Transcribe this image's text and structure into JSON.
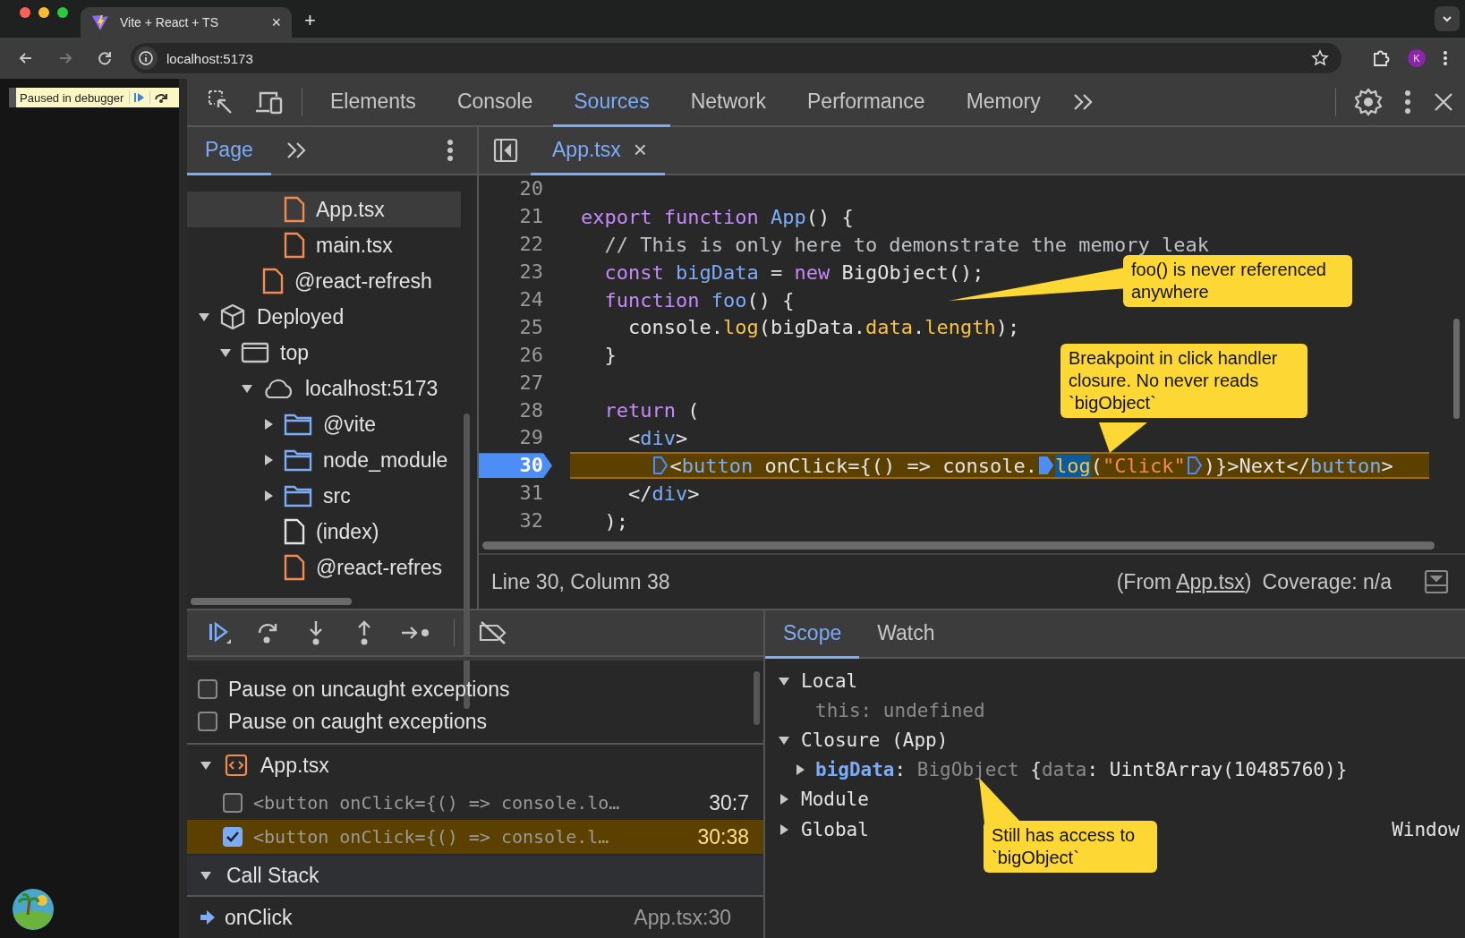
{
  "browser": {
    "tab_title": "Vite + React + TS",
    "tab_close": "×",
    "new_tab": "+",
    "address": "localhost:5173",
    "avatar": "K"
  },
  "page": {
    "paused_label": "Paused in debugger"
  },
  "devtools": {
    "tabs": [
      {
        "label": "Elements",
        "selected": false
      },
      {
        "label": "Console",
        "selected": false
      },
      {
        "label": "Sources",
        "selected": true
      },
      {
        "label": "Network",
        "selected": false
      },
      {
        "label": "Performance",
        "selected": false
      },
      {
        "label": "Memory",
        "selected": false
      }
    ]
  },
  "navigator": {
    "tab": "Page",
    "tab_selected": true,
    "tree": [
      {
        "children": [
          {
            "children": [
              {
                "children": [
                  {
                    "label": "App.tsx",
                    "kind": "file-orange",
                    "selected": true
                  },
                  {
                    "label": "main.tsx",
                    "kind": "file-orange",
                    "selected": false
                  }
                ]
              },
              {
                "label": "@react-refresh",
                "kind": "file-orange",
                "selected": false
              }
            ]
          }
        ]
      },
      {
        "label": "Deployed",
        "kind": "box",
        "selected": false,
        "expanded": true,
        "children": [
          {
            "label": "top",
            "kind": "frame",
            "selected": false,
            "expanded": true,
            "children": [
              {
                "label": "localhost:5173",
                "kind": "cloud",
                "selected": false,
                "expanded": true,
                "children": [
                  {
                    "label": "@vite",
                    "kind": "folder",
                    "selected": false,
                    "expanded": false
                  },
                  {
                    "label": "node_module",
                    "kind": "folder",
                    "selected": false,
                    "expanded": false
                  },
                  {
                    "label": "src",
                    "kind": "folder",
                    "selected": false,
                    "expanded": false
                  },
                  {
                    "label": "(index)",
                    "kind": "file-white",
                    "selected": false
                  },
                  {
                    "label": "@react-refres",
                    "kind": "file-orange",
                    "selected": false
                  }
                ]
              }
            ]
          }
        ]
      }
    ]
  },
  "editor": {
    "file_tab": "App.tsx",
    "file_tab_close": "×",
    "lines": [
      {
        "number": "20"
      },
      {
        "number": "21",
        "tokens": [
          {
            "text": "export",
            "kind": "keyword"
          },
          {
            "text": " function",
            "kind": "keyword"
          },
          {
            "text": " App",
            "kind": "name"
          },
          {
            "text": "() {",
            "kind": "plain"
          }
        ]
      },
      {
        "number": "22",
        "tokens": [
          {
            "text": "  // This is only here to demonstrate the memory leak",
            "kind": "comment"
          }
        ]
      },
      {
        "number": "23",
        "tokens": [
          {
            "text": "  const",
            "kind": "keyword"
          },
          {
            "text": " bigData",
            "kind": "name"
          },
          {
            "text": " = ",
            "kind": "plain"
          },
          {
            "text": "new",
            "kind": "keyword"
          },
          {
            "text": " BigObject();",
            "kind": "plain"
          }
        ]
      },
      {
        "number": "24",
        "tokens": [
          {
            "text": "  function",
            "kind": "keyword"
          },
          {
            "text": " foo",
            "kind": "name"
          },
          {
            "text": "() {",
            "kind": "plain"
          }
        ]
      },
      {
        "number": "25",
        "tokens": [
          {
            "text": "    console.",
            "kind": "plain"
          },
          {
            "text": "log",
            "kind": "prop"
          },
          {
            "text": "(bigData.",
            "kind": "plain"
          },
          {
            "text": "data",
            "kind": "prop"
          },
          {
            "text": ".",
            "kind": "plain"
          },
          {
            "text": "length",
            "kind": "prop"
          },
          {
            "text": ");",
            "kind": "plain"
          }
        ]
      },
      {
        "number": "26",
        "tokens": [
          {
            "text": "  }",
            "kind": "plain"
          }
        ]
      },
      {
        "number": "27"
      },
      {
        "number": "28",
        "tokens": [
          {
            "text": "  return",
            "kind": "keyword"
          },
          {
            "text": " (",
            "kind": "plain"
          }
        ]
      },
      {
        "number": "29",
        "tokens": [
          {
            "text": "    <",
            "kind": "plain"
          },
          {
            "text": "div",
            "kind": "tag"
          },
          {
            "text": ">",
            "kind": "plain"
          }
        ]
      },
      {
        "number": "30",
        "breakpoint": true,
        "paused": true,
        "tokens": [
          {
            "kind": "marker",
            "active": false
          },
          {
            "text": "<",
            "kind": "plain"
          },
          {
            "text": "button",
            "kind": "tag"
          },
          {
            "text": " onClick={() => console.",
            "kind": "plain"
          },
          {
            "kind": "marker",
            "active": true
          },
          {
            "text": "log",
            "kind": "current"
          },
          {
            "text": "(",
            "kind": "plain"
          },
          {
            "text": "\"Click\"",
            "kind": "string"
          },
          {
            "kind": "marker",
            "active": false
          },
          {
            "text": ")}>Next</",
            "kind": "plain"
          },
          {
            "text": "button",
            "kind": "tag"
          },
          {
            "text": ">",
            "kind": "plain"
          }
        ]
      },
      {
        "number": "31",
        "tokens": [
          {
            "text": "    </",
            "kind": "plain"
          },
          {
            "text": "div",
            "kind": "tag"
          },
          {
            "text": ">",
            "kind": "plain"
          }
        ]
      },
      {
        "number": "32",
        "tokens": [
          {
            "text": "  );",
            "kind": "plain"
          }
        ]
      }
    ],
    "status": {
      "position": "Line 30, Column 38",
      "from_prefix": "(From ",
      "from_link": "App.tsx",
      "from_suffix": ")",
      "coverage": "Coverage: n/a"
    }
  },
  "debugger": {
    "pause_options": [
      {
        "label": "Pause on uncaught exceptions",
        "checked": false
      },
      {
        "label": "Pause on caught exceptions",
        "checked": false
      }
    ],
    "breakpoint_file": {
      "label": "App.tsx",
      "expanded": true
    },
    "breakpoints": [
      {
        "code": "<button onClick={() => console.lo…",
        "location": "30:7",
        "checked": false,
        "paused": false
      },
      {
        "code": "<button onClick={() => console.l…",
        "location": "30:38",
        "checked": true,
        "paused": true
      }
    ],
    "call_stack": {
      "label": "Call Stack",
      "expanded": true,
      "frames": [
        {
          "name": "onClick",
          "location": "App.tsx:30",
          "current": true
        }
      ]
    }
  },
  "scope": {
    "tabs": [
      {
        "label": "Scope",
        "selected": true
      },
      {
        "label": "Watch",
        "selected": false
      }
    ],
    "sections": [
      {
        "label": "Local",
        "expanded": true,
        "entries": [
          {
            "tokens": [
              {
                "text": "this:",
                "kind": "dim"
              },
              {
                "text": " undefined",
                "kind": "dim"
              }
            ]
          }
        ]
      },
      {
        "label": "Closure (App)",
        "expanded": true,
        "entries": [
          {
            "expanded": false,
            "tokens": [
              {
                "text": "bigData",
                "kind": "key"
              },
              {
                "text": ": ",
                "kind": "plain"
              },
              {
                "text": "BigObject",
                "kind": "dim"
              },
              {
                "text": " {",
                "kind": "plain"
              },
              {
                "text": "data",
                "kind": "dim"
              },
              {
                "text": ": Uint8Array(10485760)}",
                "kind": "plain"
              }
            ]
          }
        ]
      },
      {
        "label": "Module",
        "expanded": false
      },
      {
        "label": "Global",
        "expanded": false,
        "value": "Window"
      }
    ]
  },
  "callouts": [
    {
      "text": "foo() is never referenced anywhere"
    },
    {
      "text": "Breakpoint in click handler closure. No never reads `bigObject`"
    },
    {
      "text": "Still has access to `bigObject`"
    }
  ]
}
